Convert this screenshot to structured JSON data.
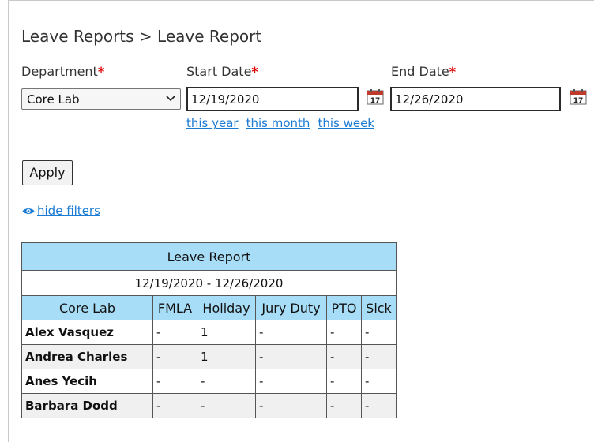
{
  "page": {
    "breadcrumb": "Leave Reports > Leave Report"
  },
  "filters": {
    "department_label": "Department",
    "required_marker": "*",
    "department_value": "Core Lab",
    "start_label": "Start Date",
    "start_value": "12/19/2020",
    "end_label": "End Date",
    "end_value": "12/26/2020",
    "quick_links": [
      "this year",
      "this month",
      "this week"
    ],
    "apply_label": "Apply",
    "hide_filters_label": "hide filters"
  },
  "report": {
    "caption": "Leave Report",
    "range": "12/19/2020 - 12/26/2020",
    "columns": [
      "Core Lab",
      "FMLA",
      "Holiday",
      "Jury Duty",
      "PTO",
      "Sick"
    ],
    "rows": [
      {
        "name": "Alex Vasquez",
        "values": [
          "-",
          "1",
          "-",
          "-",
          "-"
        ]
      },
      {
        "name": "Andrea Charles",
        "values": [
          "-",
          "1",
          "-",
          "-",
          "-"
        ]
      },
      {
        "name": "Anes Yecih",
        "values": [
          "-",
          "-",
          "-",
          "-",
          "-"
        ]
      },
      {
        "name": "Barbara Dodd",
        "values": [
          "-",
          "-",
          "-",
          "-",
          "-"
        ]
      }
    ]
  },
  "colors": {
    "link": "#1a7bd4",
    "required": "#e00000",
    "table_header": "#a8ddf7"
  },
  "icons": {
    "calendar": "calendar-icon",
    "eye": "eye-icon",
    "chevron": "chevron-down-icon"
  }
}
